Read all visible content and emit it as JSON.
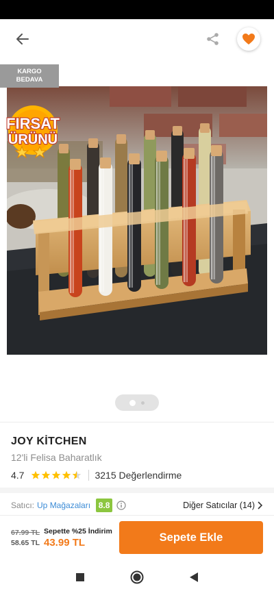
{
  "header": {
    "back_icon": "arrow-left-icon",
    "share_icon": "share-icon",
    "favorite_icon": "heart-filled-icon",
    "favorite_color": "#f27a1a"
  },
  "gallery": {
    "cargo_badge_line1": "KARGO",
    "cargo_badge_line2": "BEDAVA",
    "firsat_line1": "FIRSAT",
    "firsat_line2": "ÜRÜNÜ",
    "current_page": 1,
    "total_pages": 2
  },
  "product": {
    "brand": "JOY KİTCHEN",
    "name": "12'li Felisa Baharatlık",
    "rating": "4.7",
    "rating_value": 4.7,
    "star_count": 5,
    "review_count_text": "3215 Değerlendirme"
  },
  "seller": {
    "label": "Satıcı:",
    "name": "Up Mağazaları",
    "score": "8.8",
    "score_color": "#8cc63f",
    "other_sellers": "Diğer Satıcılar (14)"
  },
  "pricing": {
    "old_price": "67.99 TL",
    "mid_price": "58.65 TL",
    "promo_label": "Sepette %25 İndirim",
    "final_price": "43.99 TL",
    "add_to_cart": "Sepete Ekle",
    "accent_color": "#f27a1a"
  },
  "nav": {
    "items": [
      "recent-apps-icon",
      "home-icon",
      "back-triangle-icon"
    ]
  }
}
